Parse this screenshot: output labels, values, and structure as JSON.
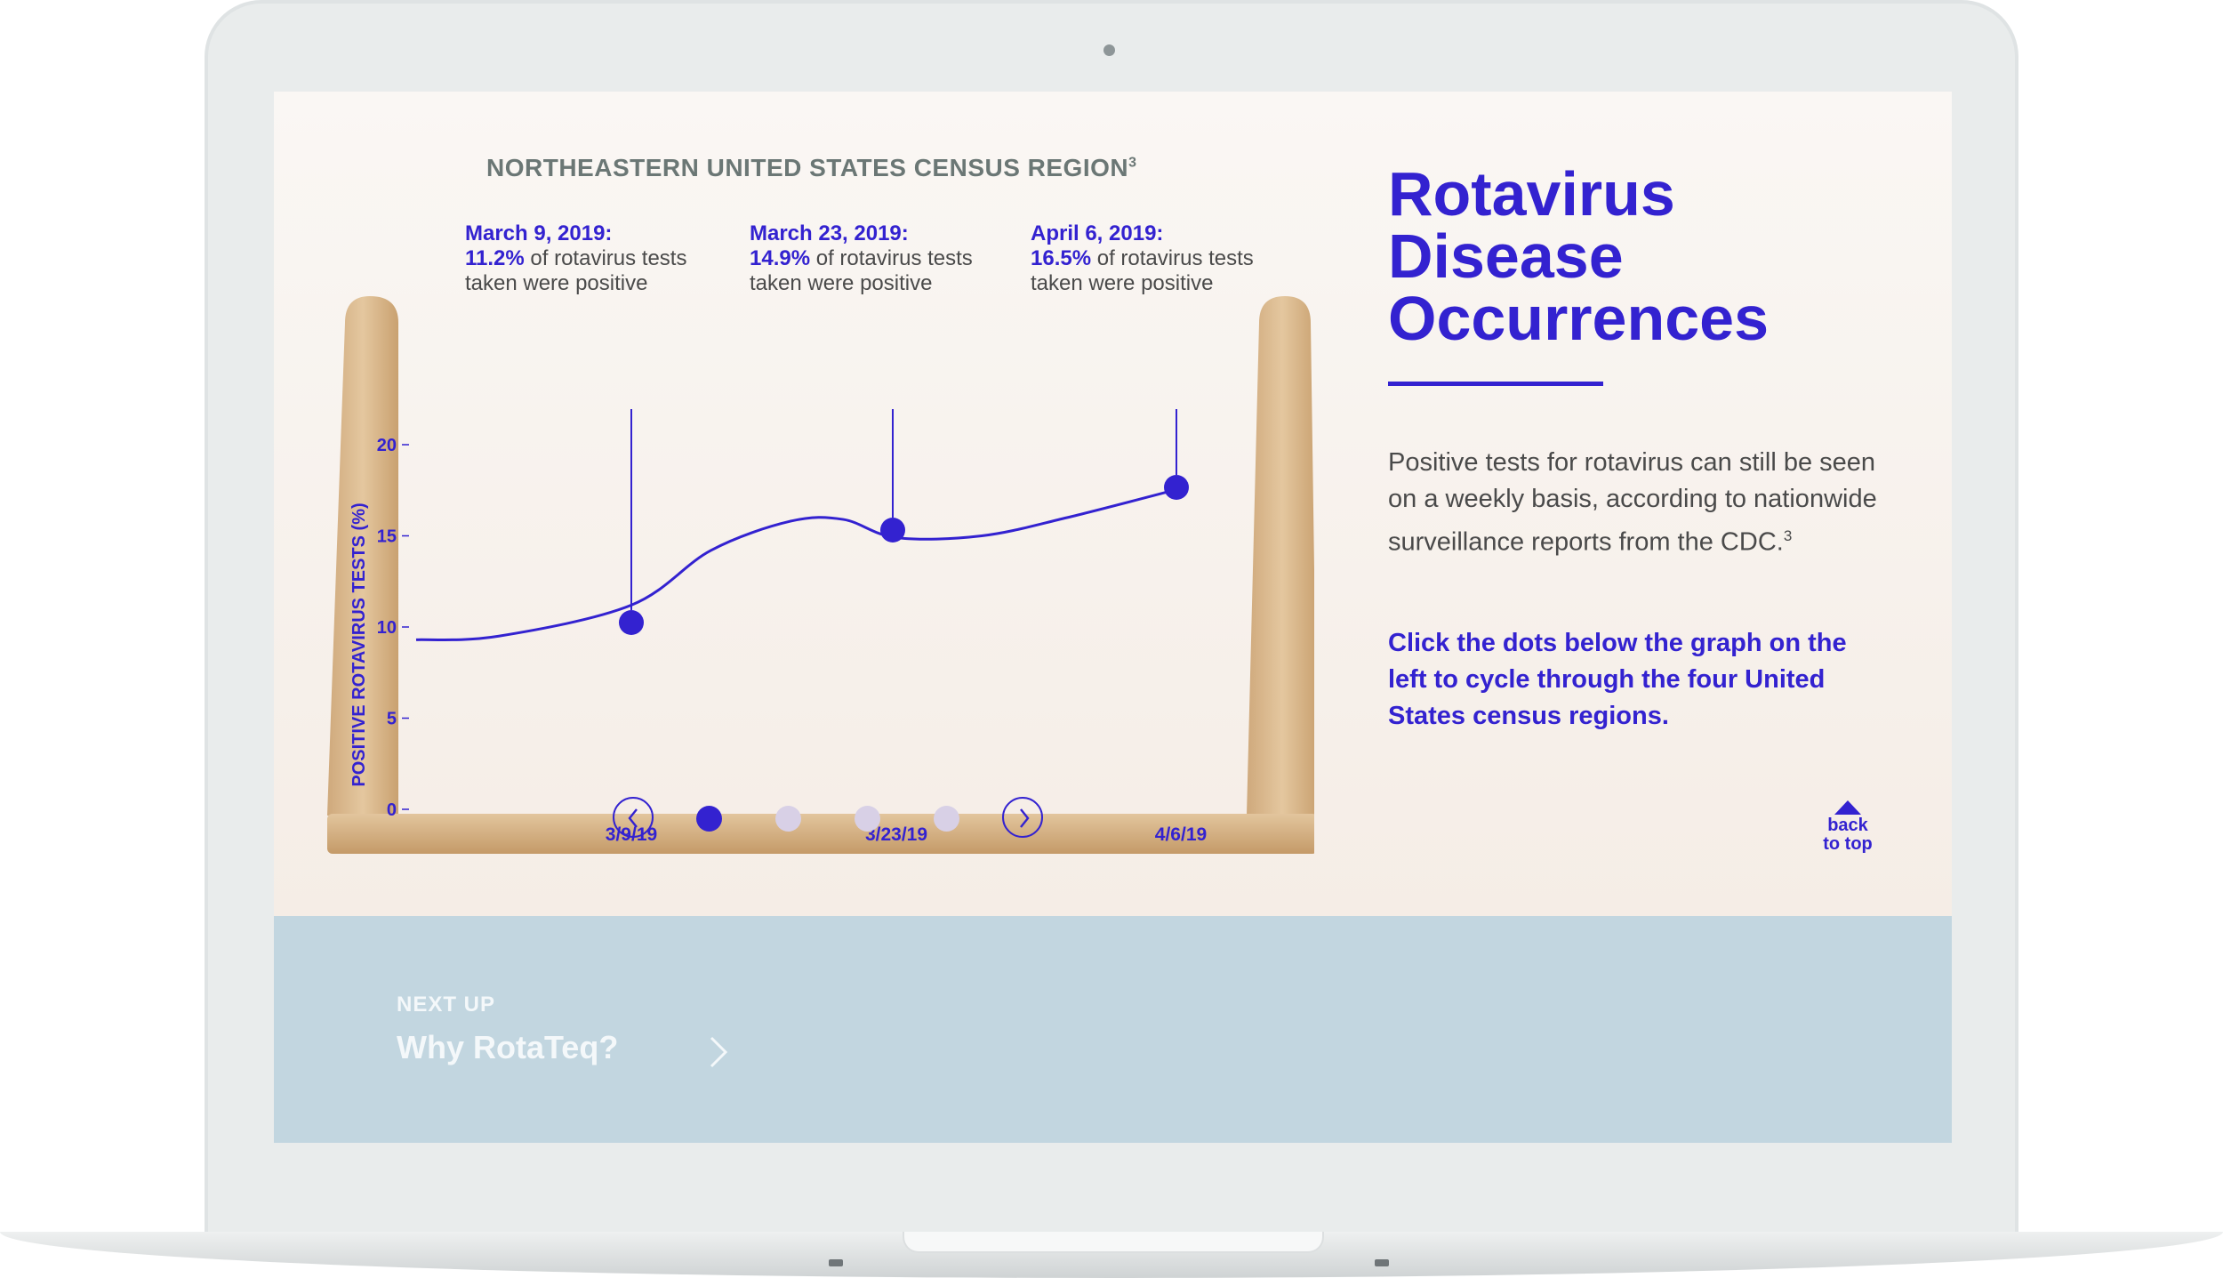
{
  "chart": {
    "title": "NORTHEASTERN UNITED STATES CENSUS REGION",
    "title_sup": "3"
  },
  "callouts": [
    {
      "date": "March 9, 2019:",
      "pct": "11.2%",
      "rest1": " of rotavirus tests",
      "rest2": "taken were positive"
    },
    {
      "date": "March 23, 2019:",
      "pct": "14.9%",
      "rest1": " of rotavirus tests",
      "rest2": "taken were positive"
    },
    {
      "date": "April 6, 2019:",
      "pct": "16.5%",
      "rest1": " of rotavirus tests",
      "rest2": "taken were positive"
    }
  ],
  "chart_data": {
    "type": "line",
    "ylabel": "POSITIVE ROTAVIRUS TESTS (%)",
    "ylim": [
      0,
      20
    ],
    "yticks": [
      0,
      5,
      10,
      15,
      20
    ],
    "x_tick_labels": [
      "3/9/19",
      "3/23/19",
      "4/6/19"
    ],
    "grid": false,
    "series": [
      {
        "curve": [
          [
            -1.0,
            9.3
          ],
          [
            -0.5,
            9.5
          ],
          [
            0.0,
            11.2
          ],
          [
            0.3,
            14.2
          ],
          [
            0.6,
            15.8
          ],
          [
            0.8,
            15.9
          ],
          [
            1.0,
            14.9
          ],
          [
            1.3,
            15.0
          ],
          [
            1.6,
            16.0
          ],
          [
            2.0,
            17.6
          ],
          [
            2.3,
            17.1
          ]
        ],
        "highlighted_points": [
          {
            "x": "3/9/19",
            "y": 11.2
          },
          {
            "x": "3/23/19",
            "y": 14.9
          },
          {
            "x": "4/6/19",
            "y": 16.5
          }
        ]
      }
    ],
    "colors": {
      "line": "#3322d0",
      "wood": "#d9b78e"
    }
  },
  "sidebar": {
    "title_lines": [
      "Rotavirus",
      "Disease",
      "Occurrences"
    ],
    "description": "Positive tests for rotavirus can still be seen on a weekly basis, according to nationwide surveillance reports from the CDC.",
    "description_sup": "3",
    "cta": "Click the dots below the graph on the left to cycle through the four United States census regions.",
    "back_top_line1": "back",
    "back_top_line2": "to top"
  },
  "carousel": {
    "dot_count": 4,
    "active_index": 0
  },
  "footer": {
    "label": "NEXT UP",
    "title": "Why RotaTeq?"
  },
  "colors": {
    "accent": "#3322d0",
    "footer_bg": "#c2d6e0",
    "page_bg": "#f7f1ec"
  }
}
